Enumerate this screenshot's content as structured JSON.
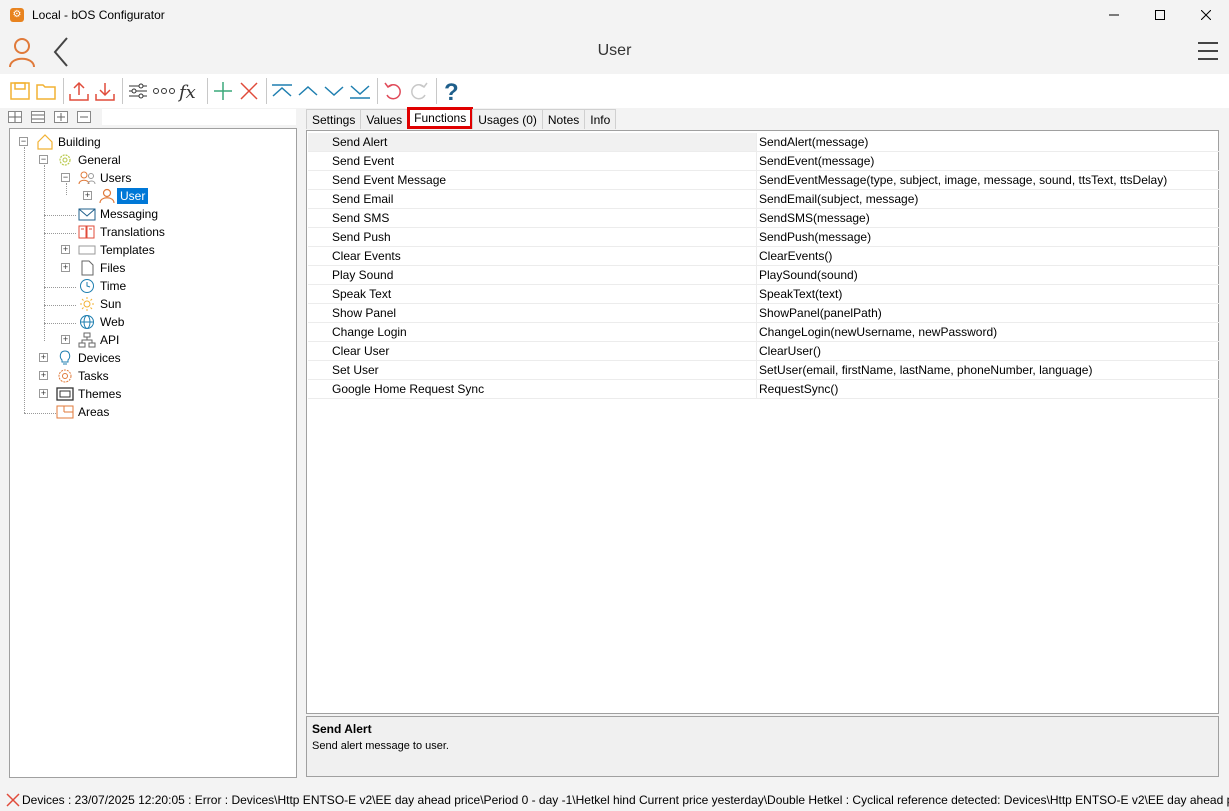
{
  "window": {
    "title": "Local - bOS Configurator"
  },
  "header": {
    "title": "User"
  },
  "tree": {
    "nodes": [
      {
        "label": "Building"
      },
      {
        "label": "General"
      },
      {
        "label": "Users"
      },
      {
        "label": "User"
      },
      {
        "label": "Messaging"
      },
      {
        "label": "Translations"
      },
      {
        "label": "Templates"
      },
      {
        "label": "Files"
      },
      {
        "label": "Time"
      },
      {
        "label": "Sun"
      },
      {
        "label": "Web"
      },
      {
        "label": "API"
      },
      {
        "label": "Devices"
      },
      {
        "label": "Tasks"
      },
      {
        "label": "Themes"
      },
      {
        "label": "Areas"
      }
    ]
  },
  "tabs": [
    {
      "label": "Settings"
    },
    {
      "label": "Values"
    },
    {
      "label": "Functions"
    },
    {
      "label": "Usages (0)"
    },
    {
      "label": "Notes"
    },
    {
      "label": "Info"
    }
  ],
  "functions": [
    {
      "name": "Send Alert",
      "signature": "SendAlert(message)"
    },
    {
      "name": "Send Event",
      "signature": "SendEvent(message)"
    },
    {
      "name": "Send Event Message",
      "signature": "SendEventMessage(type, subject, image, message, sound, ttsText, ttsDelay)"
    },
    {
      "name": "Send Email",
      "signature": "SendEmail(subject, message)"
    },
    {
      "name": "Send SMS",
      "signature": "SendSMS(message)"
    },
    {
      "name": "Send Push",
      "signature": "SendPush(message)"
    },
    {
      "name": "Clear Events",
      "signature": "ClearEvents()"
    },
    {
      "name": "Play Sound",
      "signature": "PlaySound(sound)"
    },
    {
      "name": "Speak Text",
      "signature": "SpeakText(text)"
    },
    {
      "name": "Show Panel",
      "signature": "ShowPanel(panelPath)"
    },
    {
      "name": "Change Login",
      "signature": "ChangeLogin(newUsername, newPassword)"
    },
    {
      "name": "Clear User",
      "signature": "ClearUser()"
    },
    {
      "name": "Set User",
      "signature": "SetUser(email, firstName, lastName, phoneNumber, language)"
    },
    {
      "name": "Google Home Request Sync",
      "signature": "RequestSync()"
    }
  ],
  "description": {
    "title": "Send Alert",
    "text": "Send alert message to user."
  },
  "status": {
    "text": "Devices : 23/07/2025 12:20:05 : Error : Devices\\Http ENTSO-E v2\\EE day ahead price\\Period 0 - day -1\\Hetkel hind Current price yesterday\\Double Hetkel : Cyclical reference detected: Devices\\Http ENTSO-E v2\\EE day ahead price\\P"
  },
  "colors": {
    "accent_orange": "#e8831f",
    "selection": "#0078d7",
    "active_tab_outline": "#e00000",
    "help_blue": "#1f5f8b"
  }
}
